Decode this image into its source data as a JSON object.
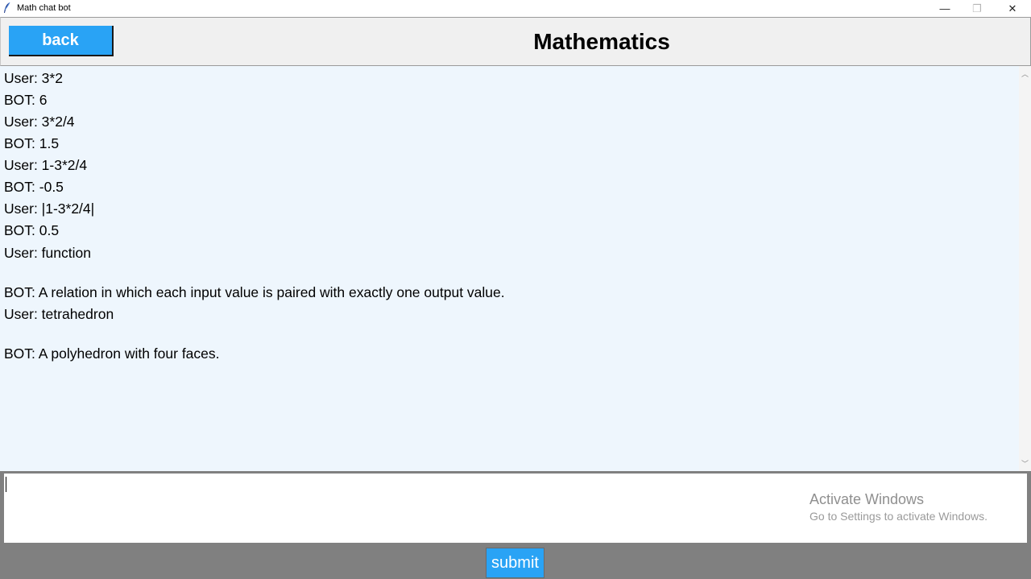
{
  "window": {
    "title": "Math chat bot",
    "minimize_icon": "minimize-icon",
    "maximize_icon": "maximize-icon",
    "close_icon": "close-icon",
    "close_glyph": "✕",
    "minimize_glyph": "—",
    "maximize_glyph": "❐"
  },
  "header": {
    "back_label": "back",
    "title": "Mathematics",
    "accent_color": "#29a3f5"
  },
  "chat": {
    "messages": [
      "User: 3*2",
      "BOT: 6",
      "User: 3*2/4",
      "BOT: 1.5",
      "User: 1-3*2/4",
      "BOT: -0.5",
      "User: |1-3*2/4|",
      "BOT: 0.5",
      "User: function",
      "BOT: A relation in which each input value is paired with exactly one output value.",
      "User: tetrahedron",
      "BOT: A polyhedron with four faces."
    ],
    "background_color": "#eef6fd"
  },
  "scrollbar": {
    "up_glyph": "︿",
    "down_glyph": "﹀"
  },
  "input": {
    "value": ""
  },
  "watermark": {
    "title": "Activate Windows",
    "subtitle": "Go to Settings to activate Windows."
  },
  "footer": {
    "submit_label": "submit"
  }
}
